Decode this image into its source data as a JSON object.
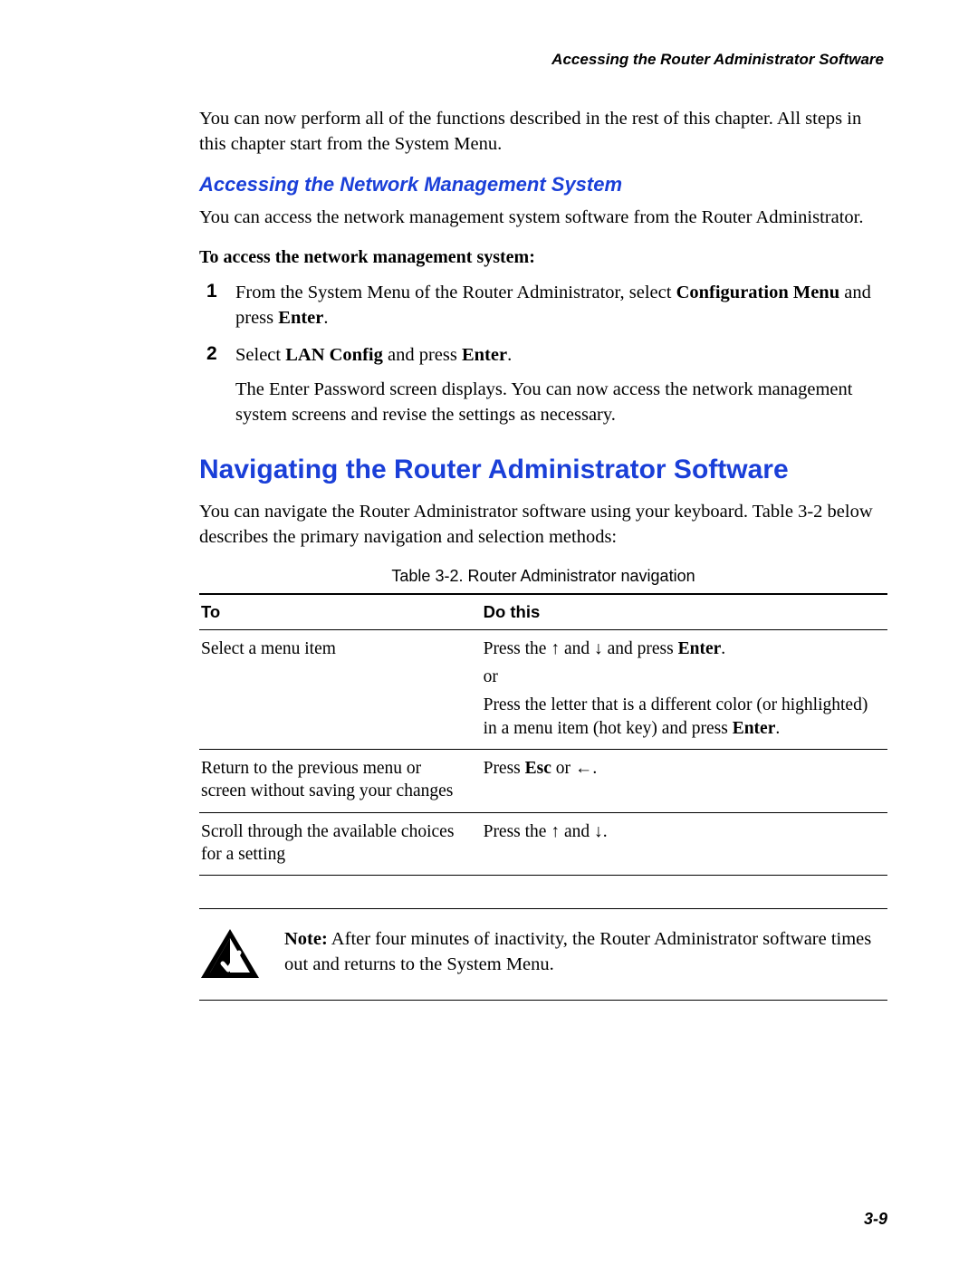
{
  "header": {
    "running": "Accessing the Router Administrator Software"
  },
  "intro": "You can now perform all of the functions described in the rest of this chapter. All steps in this chapter start from the System Menu.",
  "section_nms": {
    "heading": "Accessing the Network Management System",
    "lead": "You can access the network management system software from the Router Administrator.",
    "task_lead": "To access the network management system:",
    "steps": {
      "s1": {
        "pre": "From the System Menu of the Router Administrator, select ",
        "b1": "Configuration Menu",
        "mid": " and press ",
        "b2": "Enter",
        "post": "."
      },
      "s2": {
        "pre": "Select ",
        "b1": "LAN Config",
        "mid": " and press ",
        "b2": "Enter",
        "post": ".",
        "after": "The Enter Password screen displays. You can now access the network management system screens and revise the settings as necessary."
      }
    }
  },
  "section_nav": {
    "heading": "Navigating the Router Administrator Software",
    "lead": "You can navigate the Router Administrator software using your keyboard. Table 3-2 below describes the primary navigation and selection methods:",
    "table": {
      "caption": "Table 3-2. Router Administrator navigation",
      "head_to": "To",
      "head_do": "Do this",
      "rows": {
        "r1": {
          "to": "Select a menu item",
          "do_pre": "Press the ",
          "arr1": "↑",
          "and1": " and ",
          "arr2": "↓",
          "mid": " and press ",
          "enter": "Enter",
          "dot": ".",
          "or": "or",
          "alt_pre": "Press the letter that is a different color (or highlighted) in a menu item (hot key) and press ",
          "alt_enter": "Enter",
          "alt_dot": "."
        },
        "r2": {
          "to": "Return to the previous menu or screen without saving your changes",
          "do_pre": "Press ",
          "esc": "Esc",
          "or": " or ",
          "arr": "←",
          "dot": "."
        },
        "r3": {
          "to": "Scroll through the available choices for a setting",
          "do_pre": "Press the ",
          "arr1": "↑",
          "and": " and ",
          "arr2": "↓",
          "dot": "."
        }
      }
    }
  },
  "note": {
    "label": "Note:",
    "text": " After four minutes of inactivity, the Router Administrator software times out and returns to the System Menu."
  },
  "footer": {
    "page": "3-9"
  }
}
